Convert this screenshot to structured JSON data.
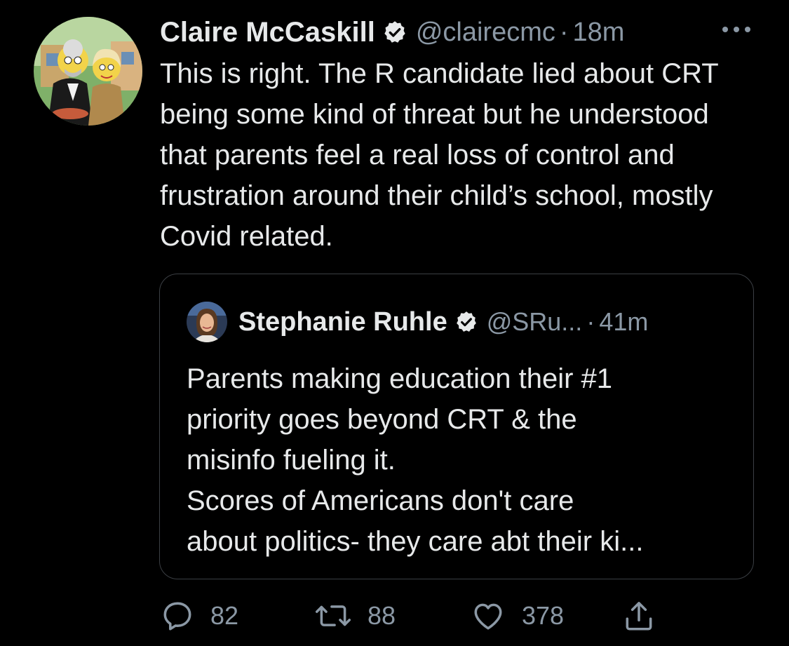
{
  "tweet": {
    "author": {
      "display_name": "Claire McCaskill",
      "handle": "@clairecmc",
      "verified": true
    },
    "separator": "·",
    "time": "18m",
    "more_icon": "more-horizontal-icon",
    "text": "This is right. The R candidate lied about CRT being some kind of threat but he understood that parents feel a real loss of control and frustration around their child’s school, mostly Covid related.",
    "quoted": {
      "display_name": "Stephanie Ruhle",
      "handle": "@SRu...",
      "verified": true,
      "separator": "·",
      "time": "41m",
      "text_lines": [
        "Parents making education their #1",
        "priority goes beyond CRT & the",
        "misinfo fueling it.",
        "Scores of Americans don't care",
        "about politics- they care abt their ki..."
      ]
    },
    "actions": {
      "reply": {
        "icon": "reply-icon",
        "count": "82"
      },
      "retweet": {
        "icon": "retweet-icon",
        "count": "88"
      },
      "like": {
        "icon": "heart-icon",
        "count": "378"
      },
      "share": {
        "icon": "share-icon"
      }
    }
  },
  "colors": {
    "background": "#000000",
    "text_primary": "#e7e9ea",
    "text_secondary": "#8b98a5",
    "border": "#3b3f44"
  }
}
